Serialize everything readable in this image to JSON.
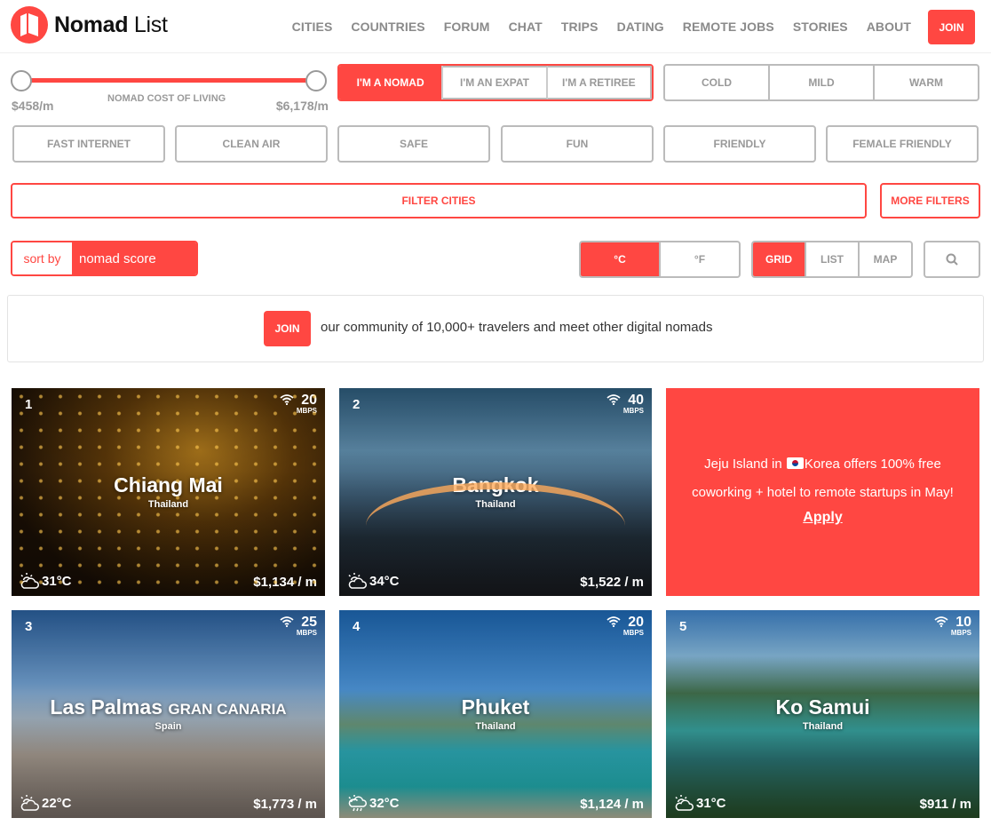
{
  "header": {
    "brand_bold": "Nomad",
    "brand_light": "List",
    "nav": [
      "CITIES",
      "COUNTRIES",
      "FORUM",
      "CHAT",
      "TRIPS",
      "DATING",
      "REMOTE JOBS",
      "STORIES",
      "ABOUT"
    ],
    "join_label": "JOIN"
  },
  "cost_slider": {
    "label": "NOMAD COST OF LIVING",
    "min_label": "$458/m",
    "max_label": "$6,178/m"
  },
  "persona_tabs": [
    "I'M A NOMAD",
    "I'M AN EXPAT",
    "I'M A RETIREE"
  ],
  "climate_tabs": [
    "COLD",
    "MILD",
    "WARM"
  ],
  "filter_chips": [
    "FAST INTERNET",
    "CLEAN AIR",
    "SAFE",
    "FUN",
    "FRIENDLY",
    "FEMALE FRIENDLY"
  ],
  "filter_button": "FILTER CITIES",
  "more_filters_button": "MORE FILTERS",
  "sort": {
    "label": "sort by",
    "value": "nomad score"
  },
  "temp_units": [
    "°C",
    "°F"
  ],
  "view_modes": [
    "GRID",
    "LIST",
    "MAP"
  ],
  "banner": {
    "join_label": "JOIN",
    "text": "our community of 10,000+ travelers and meet other digital nomads"
  },
  "cities": [
    {
      "rank": "1",
      "name": "Chiang Mai",
      "suffix": "",
      "country": "Thailand",
      "mbps": "20",
      "mbps_unit": "MBPS",
      "temp": "31°C",
      "cost": "$1,134 / m"
    },
    {
      "rank": "2",
      "name": "Bangkok",
      "suffix": "",
      "country": "Thailand",
      "mbps": "40",
      "mbps_unit": "MBPS",
      "temp": "34°C",
      "cost": "$1,522 / m"
    },
    {
      "rank": "3",
      "name": "Las Palmas",
      "suffix": "GRAN CANARIA",
      "country": "Spain",
      "mbps": "25",
      "mbps_unit": "MBPS",
      "temp": "22°C",
      "cost": "$1,773 / m"
    },
    {
      "rank": "4",
      "name": "Phuket",
      "suffix": "",
      "country": "Thailand",
      "mbps": "20",
      "mbps_unit": "MBPS",
      "temp": "32°C",
      "cost": "$1,124 / m"
    },
    {
      "rank": "5",
      "name": "Ko Samui",
      "suffix": "",
      "country": "Thailand",
      "mbps": "10",
      "mbps_unit": "MBPS",
      "temp": "31°C",
      "cost": "$911 / m"
    }
  ],
  "promo": {
    "text_before": "Jeju Island in",
    "text_after": "Korea offers 100% free coworking + hotel to remote startups in May!",
    "link": "Apply"
  },
  "colors": {
    "accent": "#ff4742",
    "muted": "#999999"
  }
}
